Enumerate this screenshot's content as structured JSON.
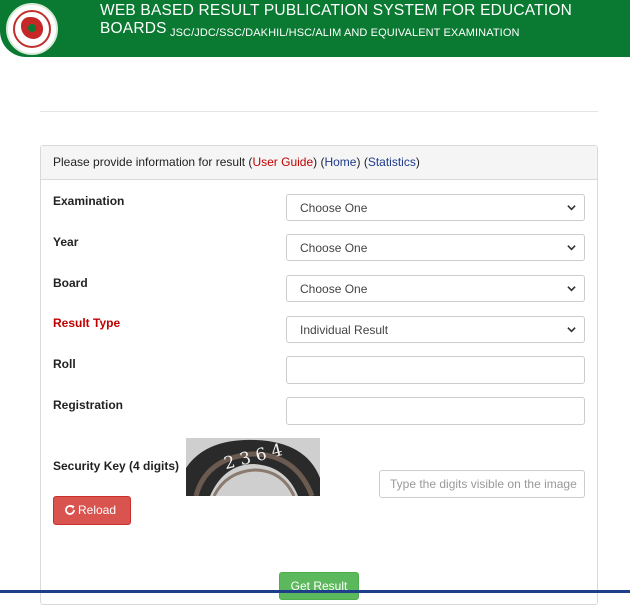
{
  "header": {
    "title": "WEB BASED RESULT PUBLICATION SYSTEM FOR EDUCATION BOARDS",
    "subtitle": "JSC/JDC/SSC/DAKHIL/HSC/ALIM AND EQUIVALENT EXAMINATION",
    "brand_color": "#0a7a32",
    "logo": "government-seal-logo"
  },
  "panel": {
    "heading_text": "Please provide information for result (",
    "user_guide": "User Guide",
    "sep1": ") (",
    "home": "Home",
    "sep2": ") (",
    "statistics": "Statistics",
    "end": ")"
  },
  "form": {
    "examination": {
      "label": "Examination",
      "value": "Choose One"
    },
    "year": {
      "label": "Year",
      "value": "Choose One"
    },
    "board": {
      "label": "Board",
      "value": "Choose One"
    },
    "result_type": {
      "label": "Result Type",
      "value": "Individual Result",
      "label_color": "#c00000"
    },
    "roll": {
      "label": "Roll",
      "value": ""
    },
    "registration": {
      "label": "Registration",
      "value": ""
    },
    "security_key": {
      "label": "Security Key (4 digits)",
      "placeholder": "Type the digits visible on the image"
    },
    "reload_label": "Reload",
    "submit_label": "Get Result"
  },
  "colors": {
    "reload": "#d9534f",
    "submit": "#5cb85c",
    "link_red": "#c00000",
    "link_blue": "#1e3b8a"
  }
}
